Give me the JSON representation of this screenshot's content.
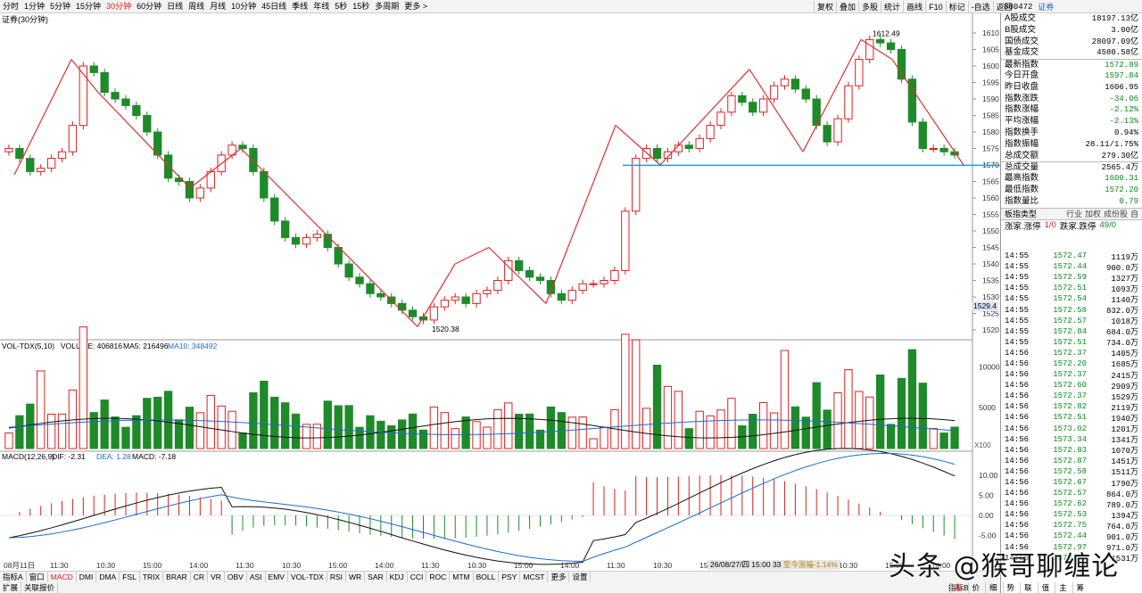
{
  "toolbar": {
    "periods": [
      "分时",
      "1分钟",
      "5分钟",
      "15分钟",
      "30分钟",
      "60分钟",
      "日线",
      "周线",
      "月线",
      "10分钟",
      "45日线",
      "季线",
      "年线",
      "5秒",
      "15秒",
      "多周期",
      "更多 >"
    ],
    "active_period": "30分钟",
    "tools": [
      "复权",
      "叠加",
      "多股",
      "统计",
      "画线",
      "F10",
      "标记",
      "-自选",
      "返回"
    ],
    "code": "880472",
    "name": "证券"
  },
  "main_chart": {
    "title": "证券(30分钟)",
    "high_label": "1612.49",
    "low_label": "1520.38",
    "y_ticks": [
      "1610",
      "1605",
      "1600",
      "1595",
      "1590",
      "1585",
      "1580",
      "1575",
      "1570",
      "1565",
      "1560",
      "1555",
      "1550",
      "1545",
      "1540",
      "1535",
      "1530",
      "1525",
      "1520"
    ],
    "cursor_price": "1529.4",
    "ref_line_price": 1569.9,
    "colors": {
      "up": "#e02020",
      "down": "#1f8a2a",
      "ma": "#111111",
      "ref": "#1f9fd6"
    }
  },
  "volume": {
    "legend_prefix": "VOL-TDX(5,10)",
    "legend_volume": "VOLUME: 406816",
    "legend_ma5": "MA5: 216496",
    "legend_ma10": "MA10: 348492",
    "y_ticks": [
      "10000",
      "5000"
    ],
    "unit": "X100"
  },
  "macd": {
    "legend_prefix": "MACD(12,26,9)",
    "legend_dif": "DIF: -2.31",
    "legend_dea": "DEA: 1.28",
    "legend_macd": "MACD: -7.18",
    "y_ticks": [
      "10.00",
      "5.00",
      "0.00",
      "-5.00"
    ]
  },
  "x_axis": [
    "08月11日",
    "11:30",
    "10:30",
    "15:00",
    "14:00",
    "11:30",
    "10:30",
    "15:00",
    "14:00",
    "11:30",
    "10:30",
    "15:00",
    "14:00",
    "11:30",
    "10:30",
    "15:00",
    "14:00",
    "11:30",
    "10:30",
    "15:00",
    "14:00"
  ],
  "date_tip": {
    "date": "26/08/27/四 15:00 33",
    "change": "至今涨幅-1.14%"
  },
  "indicator_tabs": [
    "指标A",
    "窗口",
    "MACD",
    "DMI",
    "DMA",
    "FSL",
    "TRIX",
    "BRAR",
    "CR",
    "VR",
    "OBV",
    "ASI",
    "EMV",
    "VOL-TDX",
    "RSI",
    "WR",
    "SAR",
    "KDJ",
    "CCI",
    "ROC",
    "MTM",
    "BOLL",
    "PSY",
    "MCST",
    "更多",
    "设置"
  ],
  "active_indicator": "MACD",
  "sub_tabs": [
    "扩展",
    "关联报价"
  ],
  "status_right": "指标B",
  "status_bar": [
    "笔",
    "价",
    "细",
    "势",
    "联",
    "值",
    "主",
    "筹"
  ],
  "side_info": [
    {
      "label": "A股成交",
      "value": "18197.13亿",
      "cls": ""
    },
    {
      "label": "B股成交",
      "value": "3.00亿",
      "cls": ""
    },
    {
      "label": "国债成交",
      "value": "28097.09亿",
      "cls": ""
    },
    {
      "label": "基金成交",
      "value": "4580.58亿",
      "cls": ""
    },
    {
      "label": "最新指数",
      "value": "1572.89",
      "cls": "green"
    },
    {
      "label": "今日开盘",
      "value": "1597.84",
      "cls": "green"
    },
    {
      "label": "昨日收盘",
      "value": "1606.95",
      "cls": ""
    },
    {
      "label": "指数涨跌",
      "value": "-34.06",
      "cls": "green"
    },
    {
      "label": "指数涨幅",
      "value": "-2.12%",
      "cls": "green"
    },
    {
      "label": "平均涨幅",
      "value": "-2.13%",
      "cls": "green"
    },
    {
      "label": "指数换手",
      "value": "0.94%",
      "cls": ""
    },
    {
      "label": "指数振幅",
      "value": "28.11/1.75%",
      "cls": ""
    },
    {
      "label": "总成交额",
      "value": "279.30亿",
      "cls": ""
    },
    {
      "label": "总成交量",
      "value": "2565.4万",
      "cls": ""
    },
    {
      "label": "最高指数",
      "value": "1600.31",
      "cls": "green"
    },
    {
      "label": "最低指数",
      "value": "1572.20",
      "cls": "green"
    },
    {
      "label": "指数量比",
      "value": "0.79",
      "cls": "green"
    }
  ],
  "side_tab": {
    "label": "板指类型",
    "links": [
      "行业",
      "加权",
      "成份股",
      "自"
    ]
  },
  "side_stat": {
    "rise_label": "涨家.涨停",
    "rise_value": "1/0",
    "fall_label": "跌家.跌停",
    "fall_value": "49/0"
  },
  "ticks": [
    [
      "14:55",
      "1572.47",
      "1119万"
    ],
    [
      "14:55",
      "1572.44",
      "900.0万"
    ],
    [
      "14:55",
      "1572.59",
      "1327万"
    ],
    [
      "14:55",
      "1572.51",
      "1093万"
    ],
    [
      "14:55",
      "1572.54",
      "1140万"
    ],
    [
      "14:55",
      "1572.58",
      "832.0万"
    ],
    [
      "14:55",
      "1572.57",
      "1018万"
    ],
    [
      "14:55",
      "1572.84",
      "684.0万"
    ],
    [
      "14:55",
      "1572.51",
      "734.0万"
    ],
    [
      "14:56",
      "1572.37",
      "1405万"
    ],
    [
      "14:56",
      "1572.20",
      "1685万"
    ],
    [
      "14:56",
      "1572.37",
      "2415万"
    ],
    [
      "14:56",
      "1572.60",
      "2909万"
    ],
    [
      "14:56",
      "1572.37",
      "1529万"
    ],
    [
      "14:56",
      "1572.82",
      "2119万"
    ],
    [
      "14:56",
      "1572.51",
      "1940万"
    ],
    [
      "14:56",
      "1573.02",
      "1201万"
    ],
    [
      "14:56",
      "1573.34",
      "1341万"
    ],
    [
      "14:56",
      "1572.83",
      "1070万"
    ],
    [
      "14:56",
      "1572.87",
      "1451万"
    ],
    [
      "14:56",
      "1572.58",
      "1511万"
    ],
    [
      "14:56",
      "1572.67",
      "1790万"
    ],
    [
      "14:56",
      "1572.57",
      "864.0万"
    ],
    [
      "14:56",
      "1572.62",
      "789.0万"
    ],
    [
      "14:56",
      "1572.53",
      "1394万"
    ],
    [
      "14:56",
      "1572.75",
      "764.0万"
    ],
    [
      "14:56",
      "1572.44",
      "901.0万"
    ],
    [
      "14:56",
      "1572.97",
      "971.0万"
    ],
    [
      "14:56",
      "1572.47",
      "1531万"
    ]
  ],
  "watermark": "头条 @猴哥聊缠论"
}
